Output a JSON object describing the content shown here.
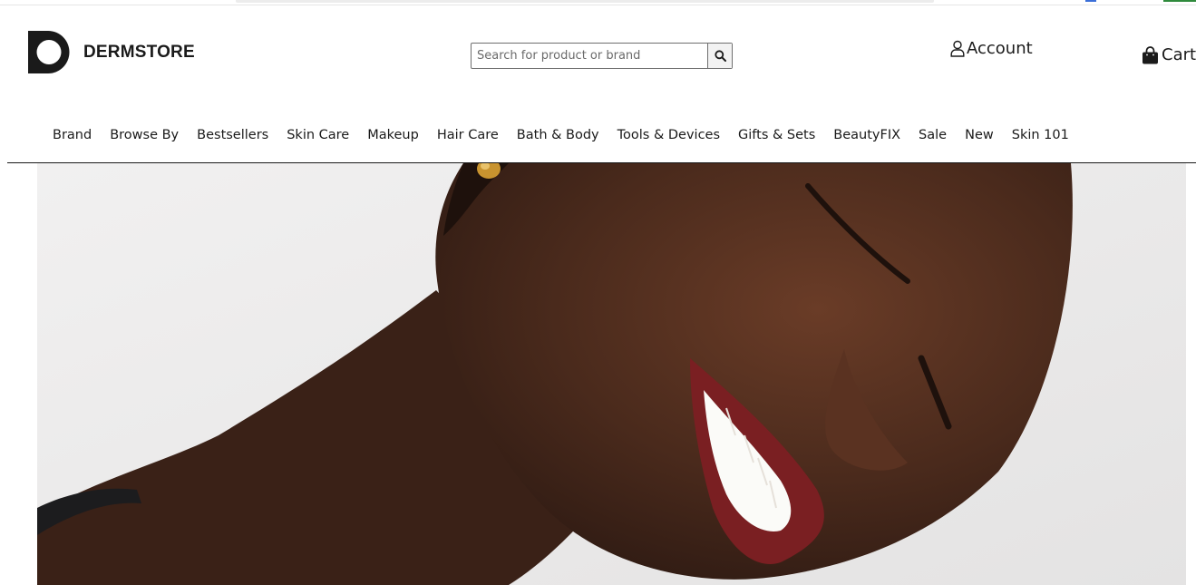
{
  "brand": {
    "name": "DERMSTORE",
    "icon": "dermstore-d-logo"
  },
  "search": {
    "placeholder": "Search for product or brand",
    "value": "",
    "button_icon": "search-icon"
  },
  "account": {
    "label": "Account",
    "icon": "user-icon"
  },
  "cart": {
    "label": "Cart",
    "icon": "shopping-bag-icon"
  },
  "nav": {
    "items": [
      {
        "label": "Brand"
      },
      {
        "label": "Browse By"
      },
      {
        "label": "Bestsellers"
      },
      {
        "label": "Skin Care"
      },
      {
        "label": "Makeup"
      },
      {
        "label": "Hair Care"
      },
      {
        "label": "Bath & Body"
      },
      {
        "label": "Tools & Devices"
      },
      {
        "label": "Gifts & Sets"
      },
      {
        "label": "BeautyFIX"
      },
      {
        "label": "Sale"
      },
      {
        "label": "New"
      },
      {
        "label": "Skin 101"
      }
    ]
  },
  "colors": {
    "text": "#1a1a1a",
    "background": "#ffffff",
    "hero_background": "#ecebeb",
    "skin": "#4a2a1c",
    "lips": "#7a1f22"
  }
}
